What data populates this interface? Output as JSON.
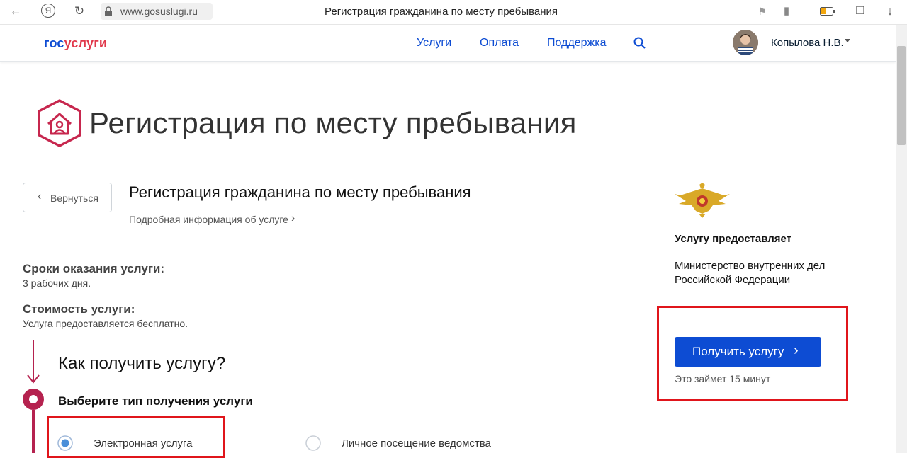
{
  "browser": {
    "url": "www.gosuslugi.ru",
    "tab_title": "Регистрация гражданина по месту пребывания",
    "yandex_glyph": "Я"
  },
  "header": {
    "logo_part1": "гос",
    "logo_part2": "услуги",
    "nav": [
      "Услуги",
      "Оплата",
      "Поддержка"
    ],
    "user_name": "Копылова Н.В."
  },
  "page": {
    "title": "Регистрация по месту пребывания",
    "back_label": "Вернуться",
    "service_title": "Регистрация гражданина по месту пребывания",
    "details_link": "Подробная информация об услуге",
    "terms_label": "Сроки оказания услуги:",
    "terms_value": "3 рабочих дня.",
    "cost_label": "Стоимость услуги:",
    "cost_value": "Услуга предоставляется бесплатно.",
    "how_title": "Как получить услугу?",
    "choose_type": "Выберите тип получения услуги",
    "options": [
      "Электронная услуга",
      "Личное посещение ведомства"
    ],
    "selected_option": "Электронная услуга"
  },
  "provider": {
    "label": "Услугу предоставляет",
    "name_line1": "Министерство внутренних дел",
    "name_line2": "Российской Федерации",
    "get_button": "Получить услугу",
    "duration": "Это займет 15 минут"
  },
  "colors": {
    "brand_blue": "#0d4cd3",
    "brand_red": "#e1384b",
    "step_accent": "#b5224f",
    "highlight_red": "#e0151b"
  }
}
